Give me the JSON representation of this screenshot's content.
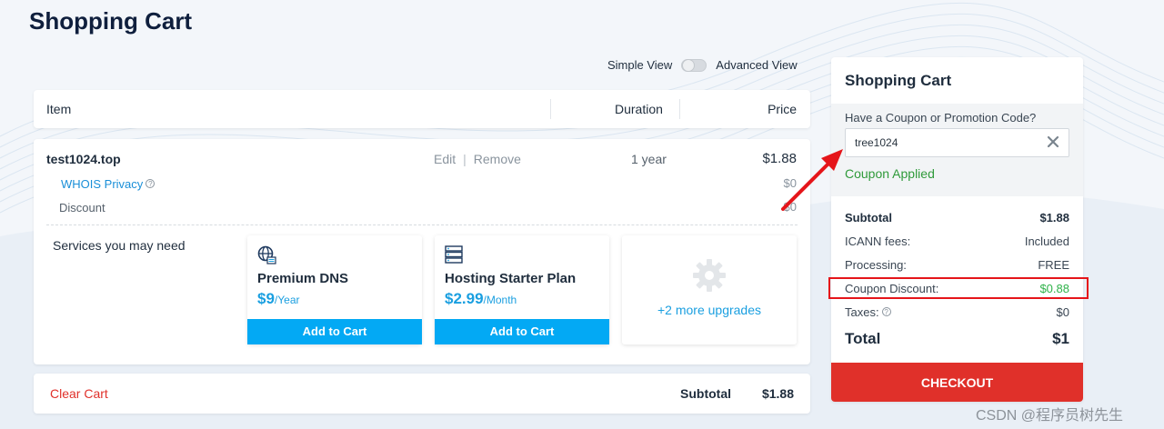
{
  "page": {
    "title": "Shopping Cart"
  },
  "view_toggle": {
    "simple_label": "Simple View",
    "advanced_label": "Advanced View"
  },
  "table_header": {
    "item": "Item",
    "duration": "Duration",
    "price": "Price"
  },
  "cart_item": {
    "domain": "test1024.top",
    "edit": "Edit",
    "separator": "|",
    "remove": "Remove",
    "duration": "1 year",
    "price": "$1.88",
    "whois_label": "WHOIS Privacy",
    "whois_help": "?",
    "whois_price": "$0",
    "discount_label": "Discount",
    "discount_price": "$0"
  },
  "services": {
    "label": "Services you may need",
    "items": [
      {
        "name": "Premium DNS",
        "price": "$9",
        "period": "/Year",
        "button": "Add to Cart",
        "icon": "globe-dns-icon"
      },
      {
        "name": "Hosting Starter Plan",
        "price": "$2.99",
        "period": "/Month",
        "button": "Add to Cart",
        "icon": "server-icon"
      }
    ],
    "more": "+2 more upgrades"
  },
  "footer": {
    "clear_cart": "Clear Cart",
    "subtotal_label": "Subtotal",
    "subtotal_value": "$1.88"
  },
  "summary": {
    "title": "Shopping Cart",
    "coupon_label": "Have a Coupon or Promotion Code?",
    "coupon_value": "tree1024",
    "coupon_status": "Coupon Applied",
    "rows": {
      "subtotal": {
        "label": "Subtotal",
        "value": "$1.88"
      },
      "icann": {
        "label": "ICANN fees:",
        "value": "Included"
      },
      "processing": {
        "label": "Processing:",
        "value": "FREE"
      },
      "coupon_discount": {
        "label": "Coupon Discount:",
        "value": "$0.88"
      },
      "taxes": {
        "label": "Taxes:",
        "help": "?",
        "value": "$0"
      },
      "total": {
        "label": "Total",
        "value": "$1"
      }
    },
    "checkout": "CHECKOUT"
  },
  "colors": {
    "accent_blue": "#03a9f4",
    "checkout_red": "#e0302a",
    "success_green": "#2f9a3a",
    "annotation_red": "#e5151a"
  },
  "watermark": "CSDN @程序员树先生"
}
